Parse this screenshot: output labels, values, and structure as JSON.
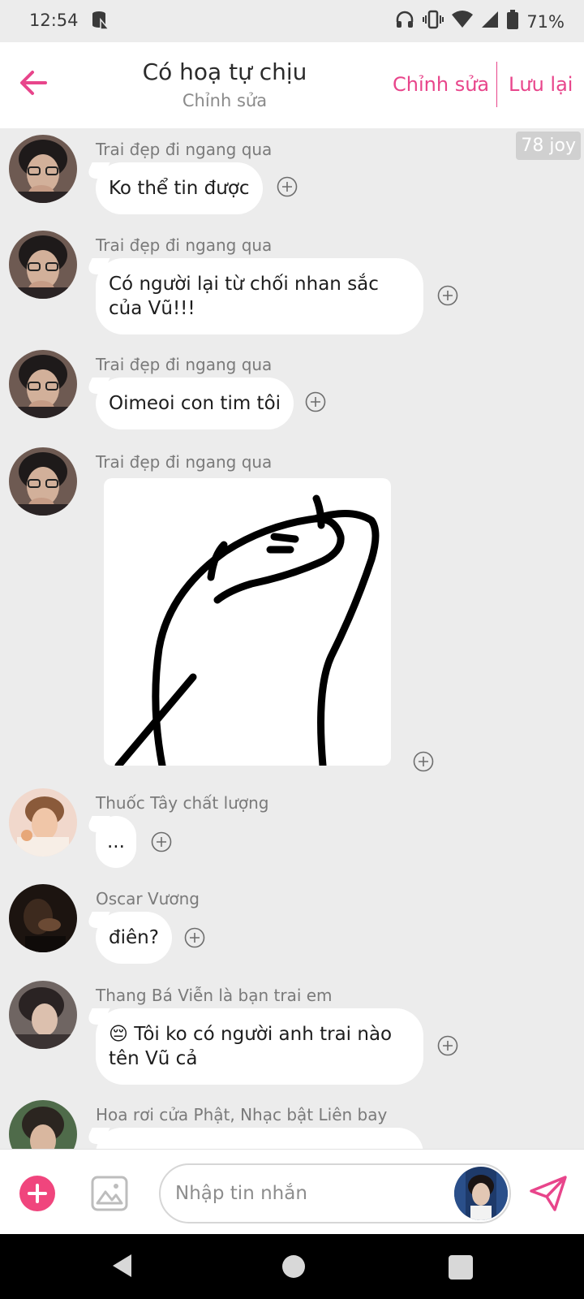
{
  "status_bar": {
    "time": "12:54",
    "battery": "71%",
    "icons": [
      "storage-icon",
      "headphones-icon",
      "vibrate-icon",
      "wifi-icon",
      "signal-icon",
      "battery-icon"
    ]
  },
  "header": {
    "title": "Có hoạ tự chịu",
    "subtitle": "Chỉnh sửa",
    "edit_label": "Chỉnh sửa",
    "save_label": "Lưu lại"
  },
  "chat": {
    "badge": "78 joy",
    "messages": [
      {
        "sender": "Trai đẹp đi ngang qua",
        "text": "Ko thể tin được"
      },
      {
        "sender": "Trai đẹp đi ngang qua",
        "text": "Có người lại từ chối nhan sắc của Vũ!!!"
      },
      {
        "sender": "Trai đẹp đi ngang qua",
        "text": "Oimeoi con tim tôi"
      },
      {
        "sender": "Trai đẹp đi ngang qua",
        "type": "sticker"
      },
      {
        "sender": "Thuốc Tây chất lượng",
        "text": "..."
      },
      {
        "sender": "Oscar Vương",
        "text": "điên?"
      },
      {
        "sender": "Thang Bá Viễn là bạn trai em",
        "text": "😔 Tôi ko có người anh trai nào tên Vũ cả"
      },
      {
        "sender": "Hoa rơi cửa Phật, Nhạc bật Liên bay",
        "text": ""
      }
    ]
  },
  "input": {
    "placeholder": "Nhập tin nhắn"
  },
  "colors": {
    "accent": "#e8458b",
    "add_button": "#f0457d",
    "chat_background": "#ececec",
    "bubble": "#ffffff"
  }
}
